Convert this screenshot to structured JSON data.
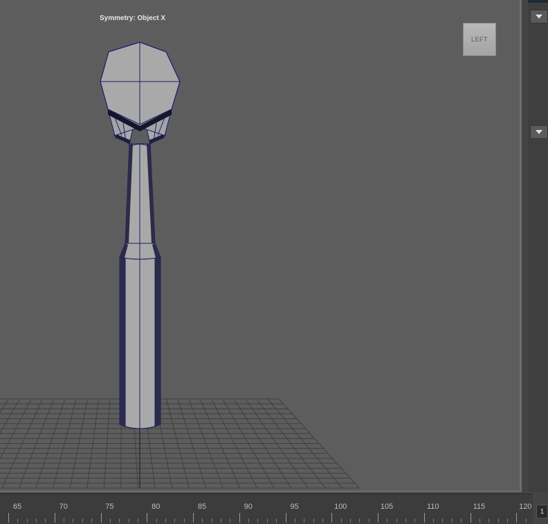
{
  "viewport": {
    "symmetry_label": "Symmetry: Object X",
    "viewcube_label": "LEFT",
    "background_color": "#5d5d5d",
    "grid_color": "#3e3e3e",
    "model_fill": "#aaaaaa",
    "wire_color": "#1a1a70"
  },
  "right_panel": {
    "dropdown_1_icon": "triangle-down-icon",
    "dropdown_2_icon": "triangle-down-icon"
  },
  "timeline": {
    "labels": [
      "65",
      "70",
      "75",
      "80",
      "85",
      "90",
      "95",
      "100",
      "105",
      "110",
      "115",
      "120"
    ],
    "current_frame": "1"
  }
}
